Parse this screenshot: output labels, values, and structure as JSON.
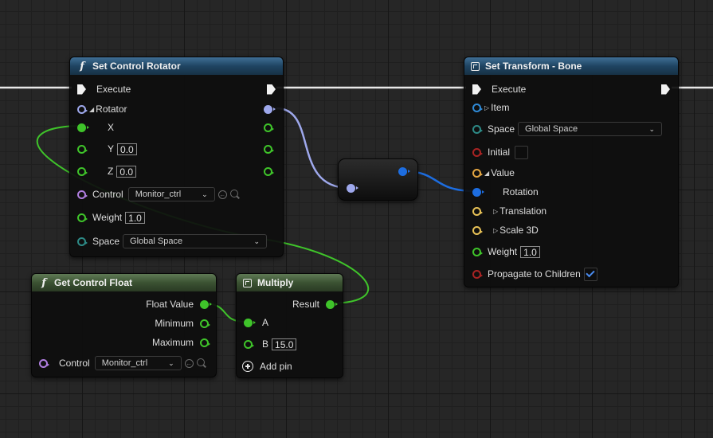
{
  "nodes": {
    "set_control_rotator": {
      "title": "Set Control Rotator",
      "icon": "function-icon",
      "pins": {
        "execute": "Execute",
        "rotator": "Rotator",
        "x": "X",
        "y": "Y",
        "y_value": "0.0",
        "z": "Z",
        "z_value": "0.0",
        "control": "Control",
        "control_value": "Monitor_ctrl",
        "weight": "Weight",
        "weight_value": "1.0",
        "space": "Space",
        "space_value": "Global Space"
      }
    },
    "set_transform_bone": {
      "title": "Set Transform - Bone",
      "icon": "node-icon",
      "pins": {
        "execute": "Execute",
        "item": "Item",
        "space": "Space",
        "space_value": "Global Space",
        "initial": "Initial",
        "value": "Value",
        "rotation": "Rotation",
        "translation": "Translation",
        "scale": "Scale 3D",
        "weight": "Weight",
        "weight_value": "1.0",
        "propagate": "Propagate to Children",
        "propagate_checked": true
      }
    },
    "get_control_float": {
      "title": "Get Control Float",
      "icon": "function-icon",
      "pins": {
        "float_value": "Float Value",
        "minimum": "Minimum",
        "maximum": "Maximum",
        "control": "Control",
        "control_value": "Monitor_ctrl"
      }
    },
    "multiply": {
      "title": "Multiply",
      "icon": "node-icon",
      "pins": {
        "result": "Result",
        "a": "A",
        "b": "B",
        "b_value": "15.0",
        "add_pin": "Add pin"
      }
    }
  },
  "colors": {
    "exec_wire": "#e8e8e8",
    "float_wire": "#3fc42a",
    "rotator_wire": "#9ea8ec",
    "struct_wire": "#1d6de0",
    "header_function": "#1f4462",
    "header_pure": "#3b5232"
  }
}
